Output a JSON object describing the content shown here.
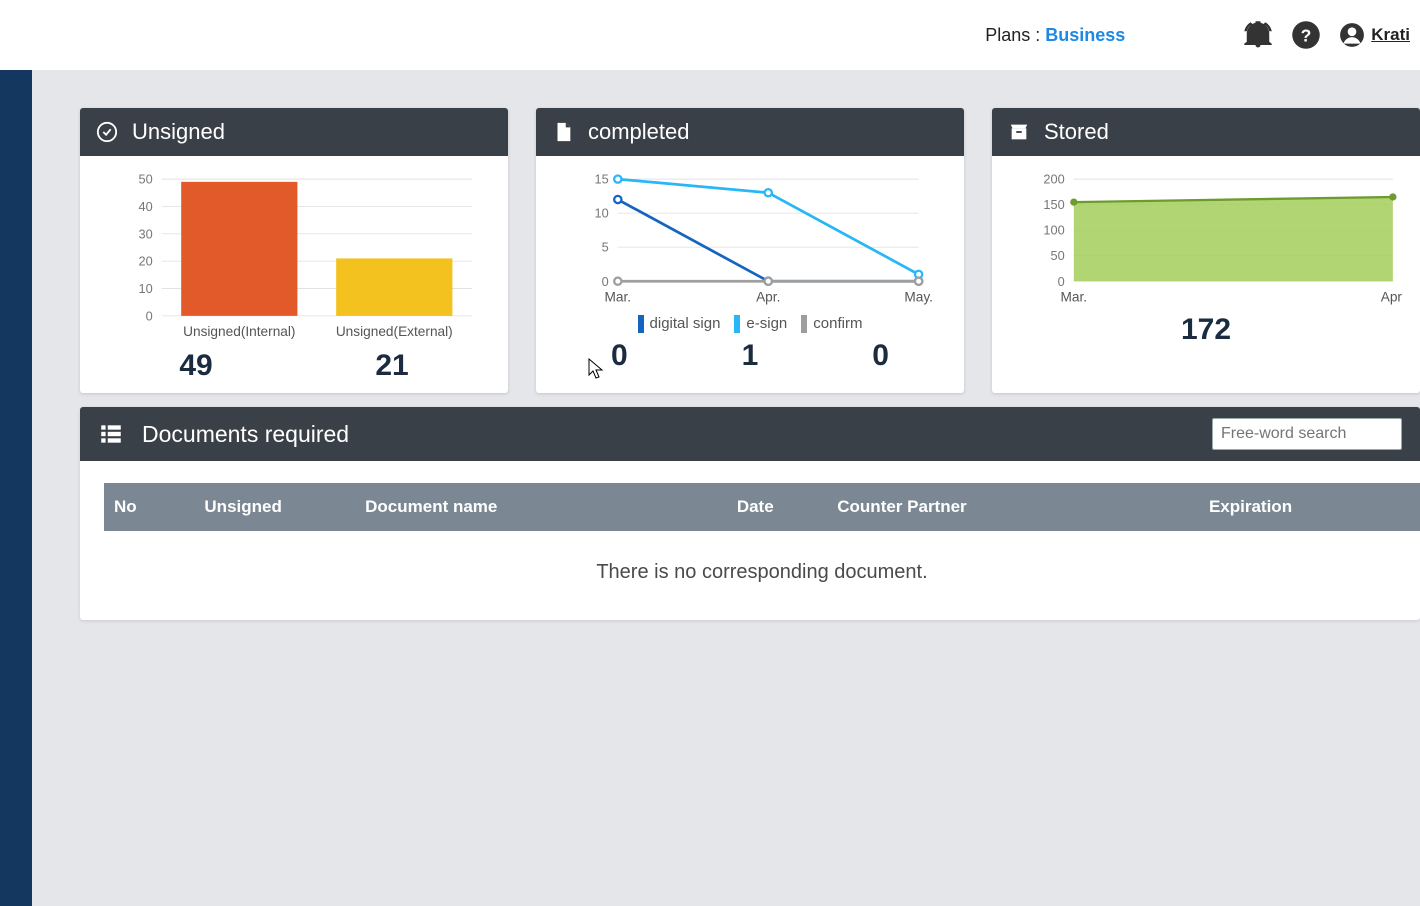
{
  "header": {
    "plans_label": "Plans : ",
    "plan_name": "Business",
    "user_name": "Krati"
  },
  "cards": {
    "unsigned": {
      "title": "Unsigned",
      "metrics": [
        "49",
        "21"
      ]
    },
    "completed": {
      "title": "completed",
      "legend": [
        "digital sign",
        "e-sign",
        "confirm"
      ],
      "metrics": [
        "0",
        "1",
        "0"
      ]
    },
    "stored": {
      "title": "Stored",
      "metric": "172"
    }
  },
  "documents": {
    "title": "Documents required",
    "search_placeholder": "Free-word search",
    "columns": {
      "no": "No",
      "unsigned": "Unsigned",
      "doc": "Document name",
      "date": "Date",
      "partner": "Counter Partner",
      "exp": "Expiration"
    },
    "empty": "There is no corresponding document."
  },
  "chart_data": [
    {
      "id": "unsigned",
      "type": "bar",
      "categories": [
        "Unsigned(Internal)",
        "Unsigned(External)"
      ],
      "values": [
        49,
        21
      ],
      "ylim": [
        0,
        50
      ],
      "yticks": [
        0,
        10,
        20,
        30,
        40,
        50
      ],
      "colors": [
        "#e35a2a",
        "#f4c21f"
      ]
    },
    {
      "id": "completed",
      "type": "line",
      "x": [
        "Mar.",
        "Apr.",
        "May."
      ],
      "series": [
        {
          "name": "digital sign",
          "values": [
            12,
            0,
            0
          ],
          "color": "#1565c0"
        },
        {
          "name": "e-sign",
          "values": [
            15,
            13,
            1
          ],
          "color": "#29b6f6"
        },
        {
          "name": "confirm",
          "values": [
            0,
            0,
            0
          ],
          "color": "#9e9e9e"
        }
      ],
      "ylim": [
        0,
        15
      ],
      "yticks": [
        0,
        5,
        10,
        15
      ]
    },
    {
      "id": "stored",
      "type": "area",
      "x": [
        "Mar.",
        "Apr."
      ],
      "values": [
        155,
        165
      ],
      "ylim": [
        0,
        200
      ],
      "yticks": [
        0,
        50,
        100,
        150,
        200
      ],
      "color": "#a5ce5b"
    }
  ]
}
